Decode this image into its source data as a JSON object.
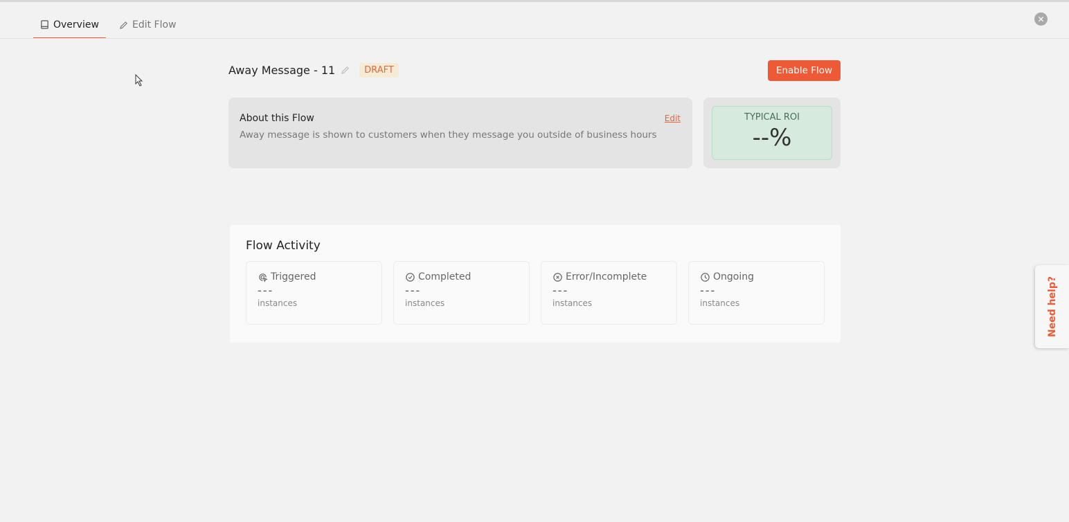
{
  "tabs": [
    {
      "label": "Overview",
      "icon": "book-icon"
    },
    {
      "label": "Edit Flow",
      "icon": "pencil-icon"
    }
  ],
  "header": {
    "title": "Away Message - 11",
    "status": "DRAFT",
    "enable_label": "Enable Flow"
  },
  "about": {
    "heading": "About this Flow",
    "description": "Away message is shown to customers when they message you outside of business hours",
    "edit_label": "Edit"
  },
  "roi": {
    "label": "TYPICAL ROI",
    "value": "--%"
  },
  "activity": {
    "title": "Flow Activity",
    "cards": [
      {
        "label": "Triggered",
        "value": "---",
        "unit": "instances"
      },
      {
        "label": "Completed",
        "value": "---",
        "unit": "instances"
      },
      {
        "label": "Error/Incomplete",
        "value": "---",
        "unit": "instances"
      },
      {
        "label": "Ongoing",
        "value": "---",
        "unit": "instances"
      }
    ]
  },
  "help": {
    "label": "Need help?"
  },
  "colors": {
    "accent": "#ee5a35",
    "roi_bg": "#d6eadd"
  }
}
